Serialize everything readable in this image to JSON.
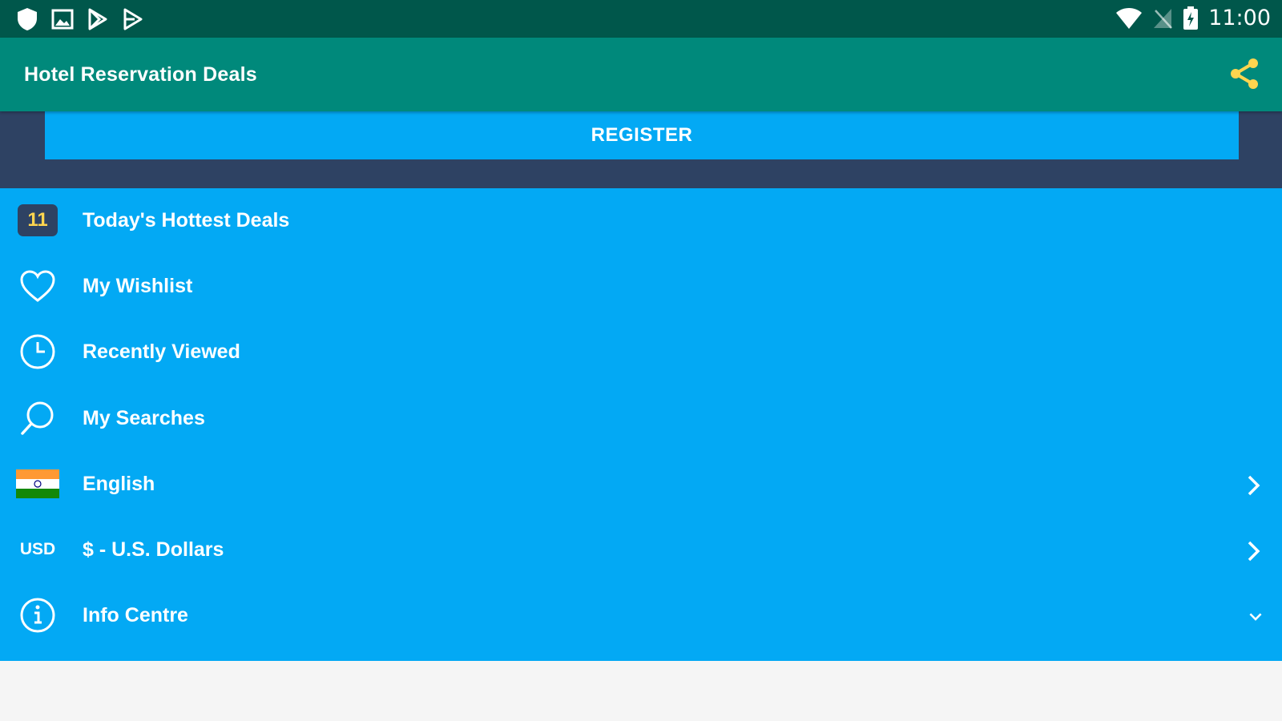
{
  "status_bar": {
    "time": "11:00",
    "left_icons": [
      "shield-icon",
      "image-icon",
      "play-store-icon",
      "play-store-icon"
    ],
    "right_icons": [
      "wifi-icon",
      "no-sim-icon",
      "battery-charging-icon"
    ]
  },
  "app_bar": {
    "title": "Hotel Reservation Deals",
    "share_icon_color": "#ffd54f"
  },
  "drawer": {
    "register_label": "REGISTER",
    "items": [
      {
        "label": "Today's Hottest Deals",
        "badge": "11",
        "icon": "calendar-badge-icon"
      },
      {
        "label": "My Wishlist",
        "icon": "heart-icon"
      },
      {
        "label": "Recently Viewed",
        "icon": "clock-icon"
      },
      {
        "label": "My Searches",
        "icon": "search-icon"
      },
      {
        "label": "English",
        "icon": "india-flag-icon",
        "trailing": "chevron-right-icon"
      },
      {
        "label": "$ - U.S. Dollars",
        "icon_text": "USD",
        "trailing": "chevron-right-icon"
      },
      {
        "label": "Info Centre",
        "icon": "info-icon",
        "trailing": "chevron-down-icon"
      }
    ]
  },
  "colors": {
    "status_bar": "#00574b",
    "app_bar": "#00897b",
    "drawer_header": "#2e4263",
    "menu_bg": "#03a9f4",
    "accent": "#ffd54f"
  }
}
